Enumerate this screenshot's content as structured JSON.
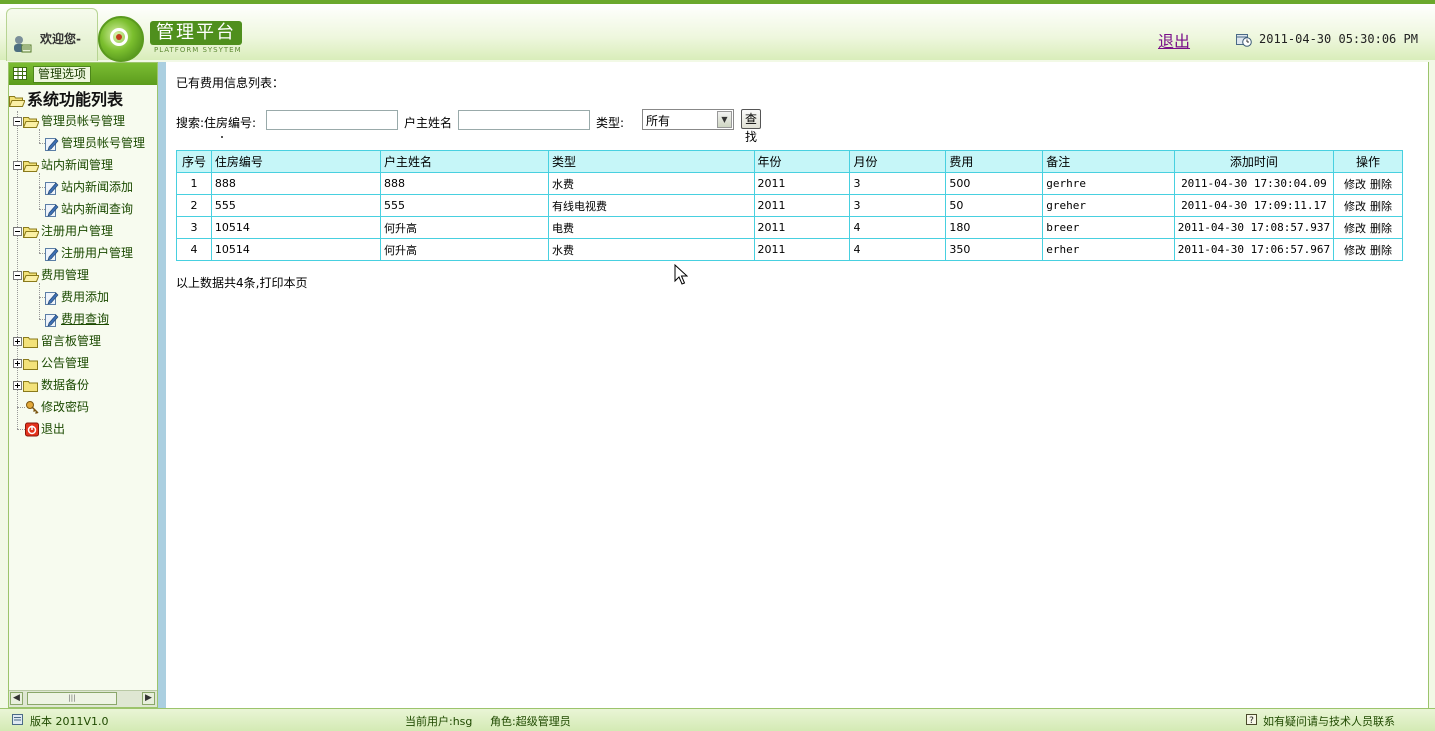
{
  "header": {
    "welcome": "欢迎您-",
    "platform_title": "管理平台",
    "platform_subtitle": "PLATFORM SYSYTEM",
    "logout": "退出",
    "datetime": "2011-04-30 05:30:06 PM"
  },
  "sidebar": {
    "head_label": "管理选项",
    "root_label": "系统功能列表",
    "items": [
      {
        "label": "管理员帐号管理",
        "type": "folder-open"
      },
      {
        "label": "管理员帐号管理",
        "type": "page"
      },
      {
        "label": "站内新闻管理",
        "type": "folder-open"
      },
      {
        "label": "站内新闻添加",
        "type": "page"
      },
      {
        "label": "站内新闻查询",
        "type": "page"
      },
      {
        "label": "注册用户管理",
        "type": "folder-open"
      },
      {
        "label": "注册用户管理",
        "type": "page"
      },
      {
        "label": "费用管理",
        "type": "folder-open"
      },
      {
        "label": "费用添加",
        "type": "page"
      },
      {
        "label": "费用查询",
        "type": "page"
      },
      {
        "label": "留言板管理",
        "type": "folder-closed"
      },
      {
        "label": "公告管理",
        "type": "folder-closed"
      },
      {
        "label": "数据备份",
        "type": "folder-closed"
      },
      {
        "label": "修改密码",
        "type": "key"
      },
      {
        "label": "退出",
        "type": "exit"
      }
    ]
  },
  "main": {
    "title": "已有费用信息列表：",
    "search": {
      "label_house": "搜索:住房编号:",
      "label_owner": "户主姓名",
      "label_type": "类型:",
      "house_value": "",
      "owner_value": "",
      "type_selected": "所有",
      "find_button": "查找"
    },
    "table": {
      "headers": [
        "序号",
        "住房编号",
        "户主姓名",
        "类型",
        "年份",
        "月份",
        "费用",
        "备注",
        "添加时间",
        "操作"
      ],
      "rows": [
        [
          "1",
          "888",
          "888",
          "水费",
          "2011",
          "3",
          "500",
          "gerhre",
          "2011-04-30 17:30:04.09"
        ],
        [
          "2",
          "555",
          "555",
          "有线电视费",
          "2011",
          "3",
          "50",
          "greher",
          "2011-04-30 17:09:11.17"
        ],
        [
          "3",
          "10514",
          "何升高",
          "电费",
          "2011",
          "4",
          "180",
          "breer",
          "2011-04-30 17:08:57.937"
        ],
        [
          "4",
          "10514",
          "何升高",
          "水费",
          "2011",
          "4",
          "350",
          "erher",
          "2011-04-30 17:06:57.967"
        ]
      ],
      "edit_label": "修改",
      "delete_label": "删除"
    },
    "summary": "以上数据共4条,打印本页"
  },
  "footer": {
    "version": "版本 2011V1.0",
    "current_user": "当前用户:hsg",
    "role": "角色:超级管理员",
    "help": "如有疑问请与技术人员联系"
  },
  "colors": {
    "accent_green": "#5c9c1d",
    "table_border": "#48d0e0",
    "table_header_bg": "#c6f6f8",
    "logout_link": "#7a0f8a"
  }
}
